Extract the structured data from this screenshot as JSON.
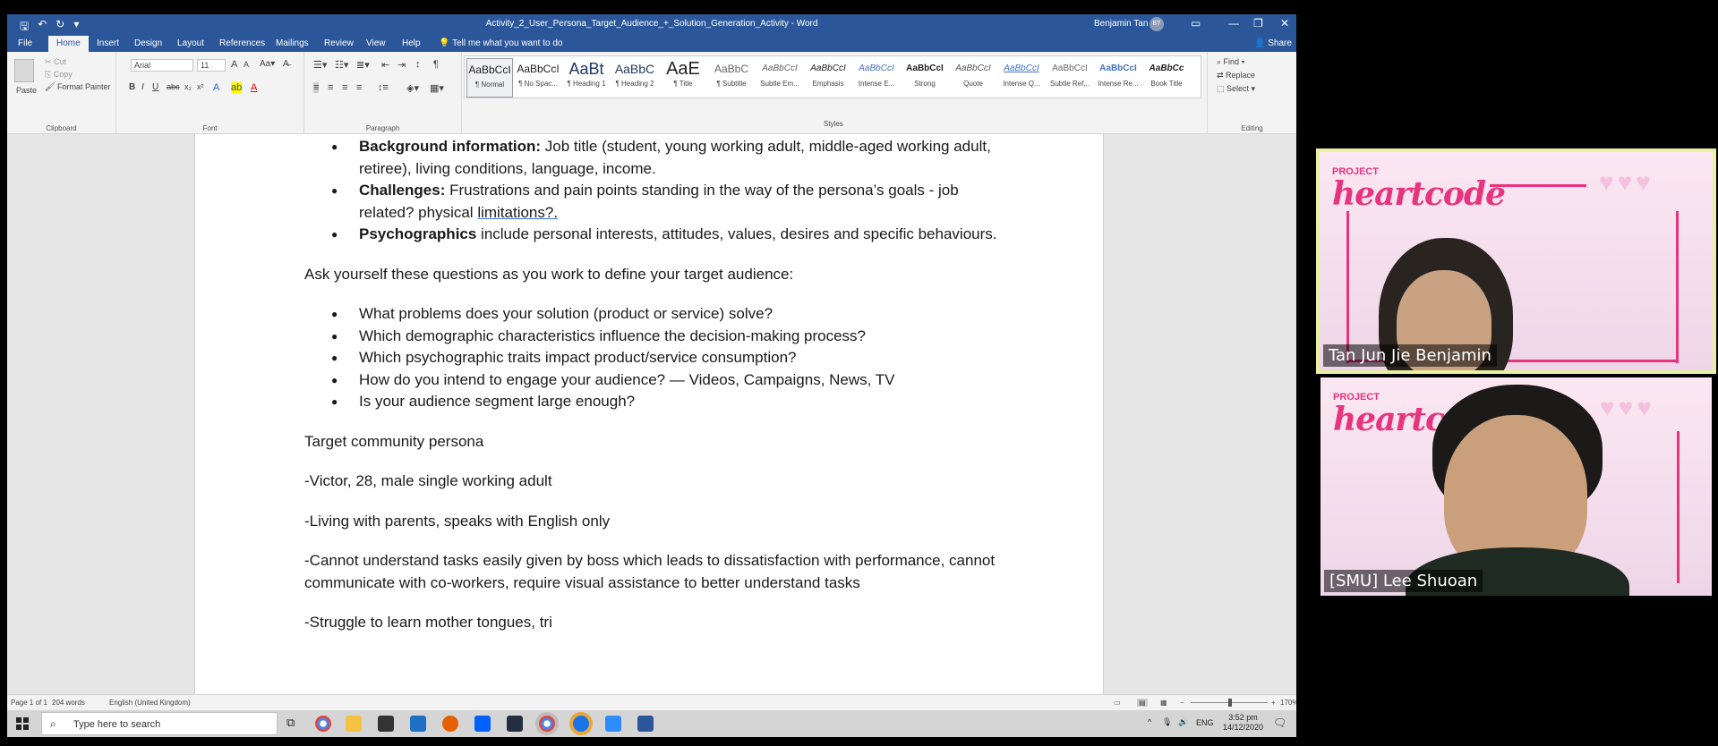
{
  "titlebar": {
    "title": "Activity_2_User_Persona_Target_Audience_+_Solution_Generation_Activity  -  Word",
    "user": "Benjamin Tan",
    "avatar": "BT"
  },
  "tabs": {
    "file": "File",
    "home": "Home",
    "insert": "Insert",
    "design": "Design",
    "layout": "Layout",
    "references": "References",
    "mailings": "Mailings",
    "review": "Review",
    "view": "View",
    "help": "Help",
    "tell": "Tell me what you want to do",
    "share": "Share"
  },
  "ribbon": {
    "clipboard": {
      "paste": "Paste",
      "cut": "Cut",
      "copy": "Copy",
      "format_painter": "Format Painter",
      "label": "Clipboard"
    },
    "font": {
      "name": "Arial",
      "size": "11",
      "label": "Font"
    },
    "paragraph": {
      "label": "Paragraph"
    },
    "styles": {
      "label": "Styles",
      "items": [
        {
          "preview": "AaBbCcI",
          "name": "¶ Normal"
        },
        {
          "preview": "AaBbCcI",
          "name": "¶ No Spac..."
        },
        {
          "preview": "AaBt",
          "name": "¶ Heading 1"
        },
        {
          "preview": "AaBbC",
          "name": "¶ Heading 2"
        },
        {
          "preview": "AaE",
          "name": "¶ Title"
        },
        {
          "preview": "AaBbC",
          "name": "¶ Subtitle"
        },
        {
          "preview": "AaBbCcI",
          "name": "Subtle Em..."
        },
        {
          "preview": "AaBbCcI",
          "name": "Emphasis"
        },
        {
          "preview": "AaBbCcI",
          "name": "Intense E..."
        },
        {
          "preview": "AaBbCcI",
          "name": "Strong"
        },
        {
          "preview": "AaBbCcI",
          "name": "Quote"
        },
        {
          "preview": "AaBbCcI",
          "name": "Intense Q..."
        },
        {
          "preview": "AaBbCcI",
          "name": "Subtle Ref..."
        },
        {
          "preview": "AaBbCcI",
          "name": "Intense Re..."
        },
        {
          "preview": "AaBbCc",
          "name": "Book Title"
        }
      ]
    },
    "editing": {
      "find": "Find",
      "replace": "Replace",
      "select": "Select",
      "label": "Editing"
    }
  },
  "document": {
    "bullets_top": [
      {
        "bold": "Background information:",
        "text": " Job title (student, young working adult, middle-aged working adult, retiree), living conditions, language, income."
      },
      {
        "bold": "Challenges:",
        "text": " Frustrations and pain points standing in the way of the persona’s goals - job related? physical ",
        "underlined": "limitations?."
      },
      {
        "bold": "Psychographics",
        "text": " include personal interests, attitudes, values, desires and specific behaviours."
      }
    ],
    "intro": "Ask yourself these questions as you work to define your target audience:",
    "questions": [
      "What problems does your solution (product or service) solve?",
      "Which demographic characteristics influence the decision-making process?",
      "Which psychographic traits impact product/service consumption?",
      "How do you intend to engage your audience? — Videos, Campaigns, News, TV",
      "Is your audience segment large enough?"
    ],
    "persona_heading": "Target community persona",
    "persona_lines": [
      "-Victor, 28, male single working adult",
      "-Living with parents, speaks with English only",
      "-Cannot understand tasks easily given by boss which leads to dissatisfaction with performance, cannot communicate with co-workers, require visual assistance to better understand tasks",
      "-Struggle to learn mother tongues, tri"
    ]
  },
  "statusbar": {
    "page": "Page 1 of 1",
    "words": "204 words",
    "language": "English (United Kingdom)",
    "zoom": "170%"
  },
  "taskbar": {
    "search_placeholder": "Type here to search",
    "lang": "ENG",
    "time": "3:52 pm",
    "date": "14/12/2020"
  },
  "video": {
    "brand_small": "PROJECT",
    "brand_large": "heartcode",
    "participants": [
      {
        "name": "Tan Jun Jie Benjamin"
      },
      {
        "name": "[SMU] Lee Shuoan"
      }
    ]
  }
}
